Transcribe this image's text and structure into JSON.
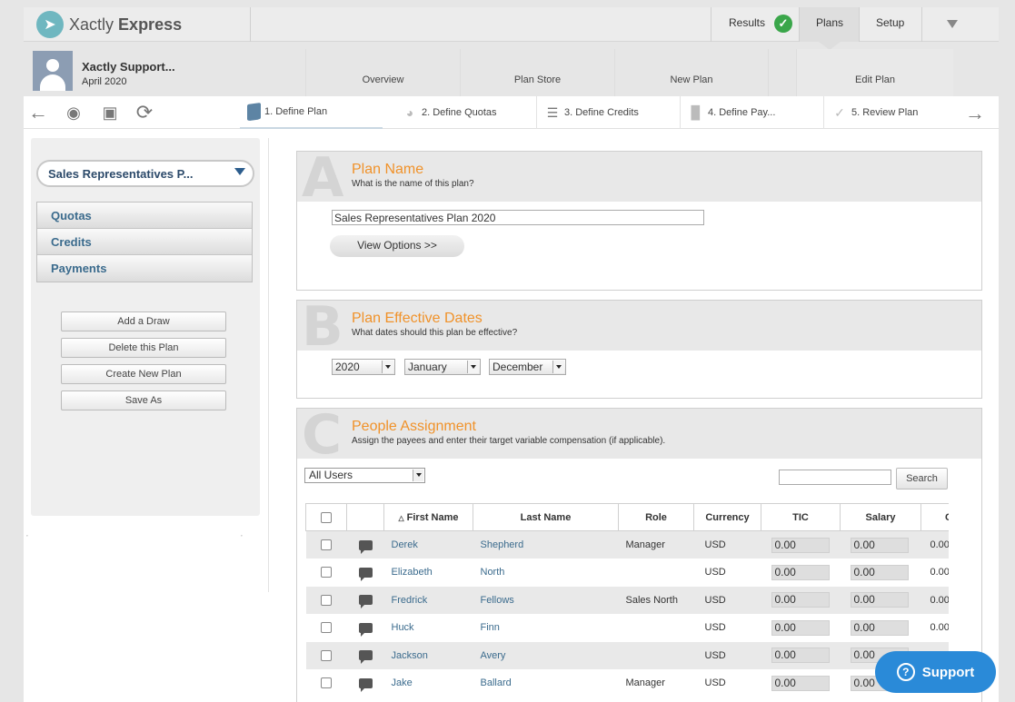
{
  "app": {
    "logo_text_light": "Xactly",
    "logo_text_bold": "Express",
    "logo_icon": "rocket-icon"
  },
  "topnav": {
    "results": "Results",
    "plans": "Plans",
    "setup": "Setup",
    "results_status_icon": "check-icon"
  },
  "user": {
    "name": "Xactly Support...",
    "period": "April 2020"
  },
  "subtabs": [
    "Overview",
    "Plan Store",
    "New Plan",
    "Edit Plan"
  ],
  "toolbar": {
    "icons": [
      "back-arrow-icon",
      "refresh-icon",
      "save-icon",
      "redo-icon"
    ],
    "next_icon": "next-arrow-icon"
  },
  "steps": [
    {
      "label": "1. Define Plan",
      "icon": "document-icon"
    },
    {
      "label": "2. Define Quotas",
      "icon": "gauge-icon"
    },
    {
      "label": "3. Define Credits",
      "icon": "list-icon"
    },
    {
      "label": "4. Define Pay...",
      "icon": "bar-chart-icon"
    },
    {
      "label": "5. Review Plan",
      "icon": "checkmark-icon"
    }
  ],
  "sidebar": {
    "plan_select": "Sales Representatives P...",
    "menu": [
      "Quotas",
      "Credits",
      "Payments"
    ],
    "buttons": [
      "Add a Draw",
      "Delete this Plan",
      "Create New Plan",
      "Save As"
    ]
  },
  "section_a": {
    "letter": "A",
    "title": "Plan Name",
    "subtitle": "What is the name of this plan?",
    "plan_name_value": "Sales Representatives Plan 2020",
    "view_options": "View Options >>"
  },
  "section_b": {
    "letter": "B",
    "title": "Plan Effective Dates",
    "subtitle": "What dates should this plan be effective?",
    "year": "2020",
    "start_month": "January",
    "end_month": "December"
  },
  "section_c": {
    "letter": "C",
    "title": "People Assignment",
    "subtitle": "Assign the payees and enter their target variable compensation (if applicable).",
    "users_filter": "All Users",
    "search_button": "Search"
  },
  "table": {
    "headers": [
      "First Name",
      "Last Name",
      "Role",
      "Currency",
      "TIC",
      "Salary",
      "C"
    ],
    "rows": [
      {
        "first": "Derek",
        "last": "Shepherd",
        "role": "Manager",
        "currency": "USD",
        "tic": "0.00",
        "salary": "0.00",
        "extra": "0.00"
      },
      {
        "first": "Elizabeth",
        "last": "North",
        "role": "",
        "currency": "USD",
        "tic": "0.00",
        "salary": "0.00",
        "extra": "0.00"
      },
      {
        "first": "Fredrick",
        "last": "Fellows",
        "role": "Sales North",
        "currency": "USD",
        "tic": "0.00",
        "salary": "0.00",
        "extra": "0.00"
      },
      {
        "first": "Huck",
        "last": "Finn",
        "role": "",
        "currency": "USD",
        "tic": "0.00",
        "salary": "0.00",
        "extra": "0.00"
      },
      {
        "first": "Jackson",
        "last": "Avery",
        "role": "",
        "currency": "USD",
        "tic": "0.00",
        "salary": "0.00",
        "extra": ""
      },
      {
        "first": "Jake",
        "last": "Ballard",
        "role": "Manager",
        "currency": "USD",
        "tic": "0.00",
        "salary": "0.00",
        "extra": ""
      }
    ]
  },
  "support": {
    "label": "Support",
    "icon": "question-icon"
  },
  "colors": {
    "accent_orange": "#f0922a",
    "link_blue": "#3b6b8d",
    "support_blue": "#2a8ad8",
    "success_green": "#3aa64a"
  }
}
